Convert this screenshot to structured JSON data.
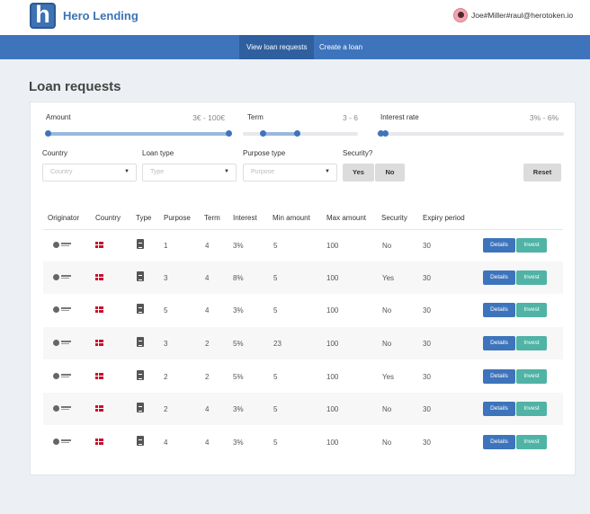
{
  "header": {
    "logo_letter": "h",
    "brand": "Hero Lending",
    "user": "Joe#Miller#raul@herotoken.io"
  },
  "nav": {
    "tabs": [
      {
        "label": "View loan requests",
        "active": true
      },
      {
        "label": "Create a loan",
        "active": false
      }
    ]
  },
  "page_title": "Loan requests",
  "filters": {
    "amount": {
      "label": "Amount",
      "range": "3€ - 100€"
    },
    "term": {
      "label": "Term",
      "range": "3 - 6"
    },
    "interest": {
      "label": "Interest rate",
      "range": "3% - 6%"
    },
    "country": {
      "label": "Country",
      "placeholder": "Country"
    },
    "loan_type": {
      "label": "Loan type",
      "placeholder": "Type"
    },
    "purpose_type": {
      "label": "Purpose type",
      "placeholder": "Purpose"
    },
    "security": {
      "label": "Security?",
      "yes": "Yes",
      "no": "No"
    },
    "reset": "Reset"
  },
  "table": {
    "headers": [
      "Originator",
      "Country",
      "Type",
      "Purpose",
      "Term",
      "Interest",
      "Min amount",
      "Max amount",
      "Security",
      "Expiry period"
    ],
    "details_label": "Details",
    "invest_label": "Invest",
    "rows": [
      {
        "purpose": "1",
        "term": "4",
        "interest": "3%",
        "min": "5",
        "max": "100",
        "security": "No",
        "expiry": "30"
      },
      {
        "purpose": "3",
        "term": "4",
        "interest": "8%",
        "min": "5",
        "max": "100",
        "security": "Yes",
        "expiry": "30"
      },
      {
        "purpose": "5",
        "term": "4",
        "interest": "3%",
        "min": "5",
        "max": "100",
        "security": "No",
        "expiry": "30"
      },
      {
        "purpose": "3",
        "term": "2",
        "interest": "5%",
        "min": "23",
        "max": "100",
        "security": "No",
        "expiry": "30"
      },
      {
        "purpose": "2",
        "term": "2",
        "interest": "5%",
        "min": "5",
        "max": "100",
        "security": "Yes",
        "expiry": "30"
      },
      {
        "purpose": "2",
        "term": "4",
        "interest": "3%",
        "min": "5",
        "max": "100",
        "security": "No",
        "expiry": "30"
      },
      {
        "purpose": "4",
        "term": "4",
        "interest": "3%",
        "min": "5",
        "max": "100",
        "security": "No",
        "expiry": "30"
      }
    ]
  }
}
